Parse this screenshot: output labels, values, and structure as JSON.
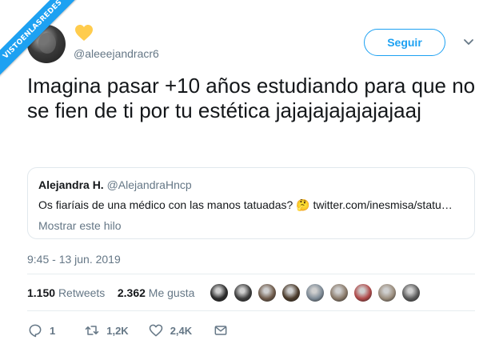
{
  "watermark": {
    "text": "VISTOENLASREDES"
  },
  "header": {
    "handle": "@aleeejandracr6",
    "follow_label": "Seguir",
    "heart_color": "#ffcc4d"
  },
  "tweet": {
    "text": "Imagina pasar +10 años estudiando para que no se fien de ti por tu estética jajajajajajajajaaj",
    "timestamp": "9:45 - 13 jun. 2019"
  },
  "quote": {
    "name": "Alejandra H.",
    "handle": "@AlejandraHncp",
    "text": "Os fiaríais de una médico con las manos tatuadas? 🤔 twitter.com/inesmisa/statu…",
    "more_label": "Mostrar este hilo"
  },
  "stats": {
    "retweets_count": "1.150",
    "retweets_label": "Retweets",
    "likes_count": "2.362",
    "likes_label": "Me gusta"
  },
  "likers": [
    {
      "icon": "avatar"
    },
    {
      "icon": "avatar"
    },
    {
      "icon": "avatar"
    },
    {
      "icon": "avatar"
    },
    {
      "icon": "avatar"
    },
    {
      "icon": "avatar"
    },
    {
      "icon": "avatar"
    },
    {
      "icon": "avatar"
    },
    {
      "icon": "avatar"
    }
  ],
  "actions": {
    "reply_count": "1",
    "retweet_count": "1,2K",
    "like_count": "2,4K"
  },
  "colors": {
    "accent": "#1da1f2",
    "secondary_text": "#657786",
    "border": "#e1e8ed"
  }
}
